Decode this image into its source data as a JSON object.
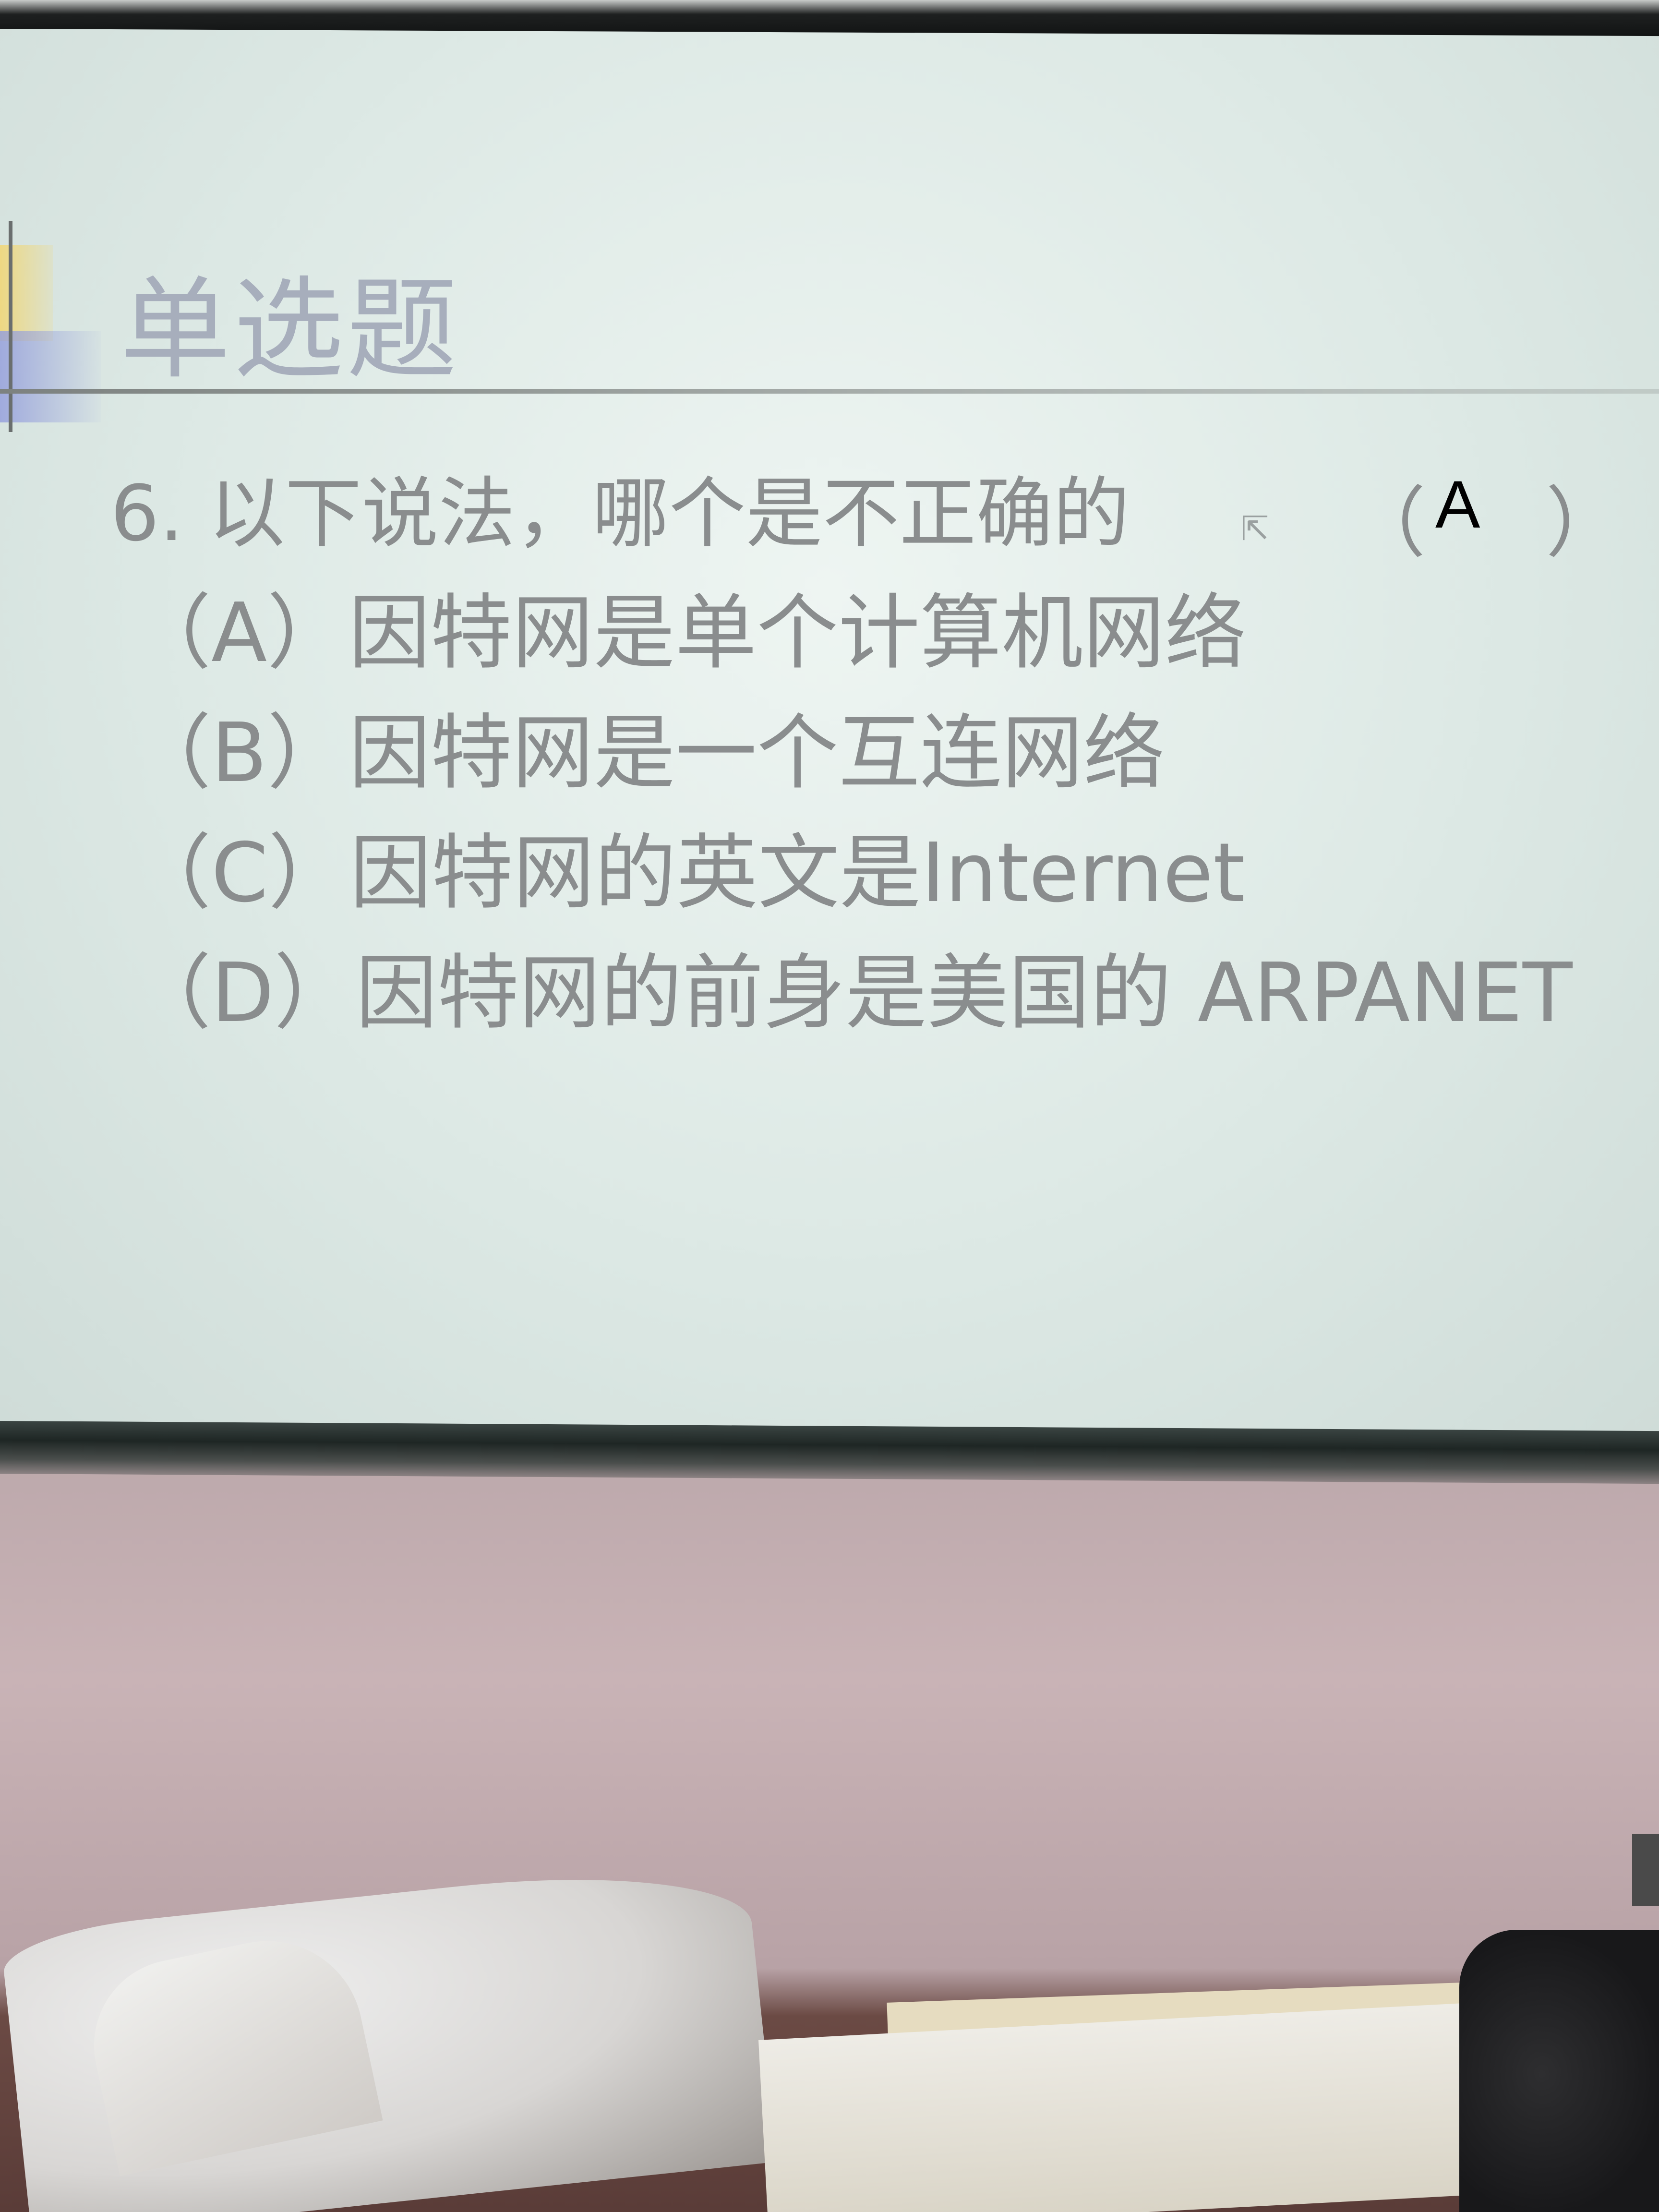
{
  "slide": {
    "title": "单选题",
    "question": "6. 以下说法，哪个是不正确的",
    "cursor": "⇱",
    "open_paren": "（",
    "answer": "A",
    "close_paren": "）",
    "options": [
      {
        "label": "（A）因特网是单个计算机网络"
      },
      {
        "label": "（B）因特网是一个互连网络"
      },
      {
        "label": "（C）因特网的英文是Internet"
      },
      {
        "label": "（D）因特网的前身是美国的 ARPANET"
      }
    ]
  },
  "colors": {
    "title_color": "#a7aebc",
    "body_text": "#8a8d8e",
    "answer_text": "#000000",
    "wall": "#c9b3b6"
  }
}
